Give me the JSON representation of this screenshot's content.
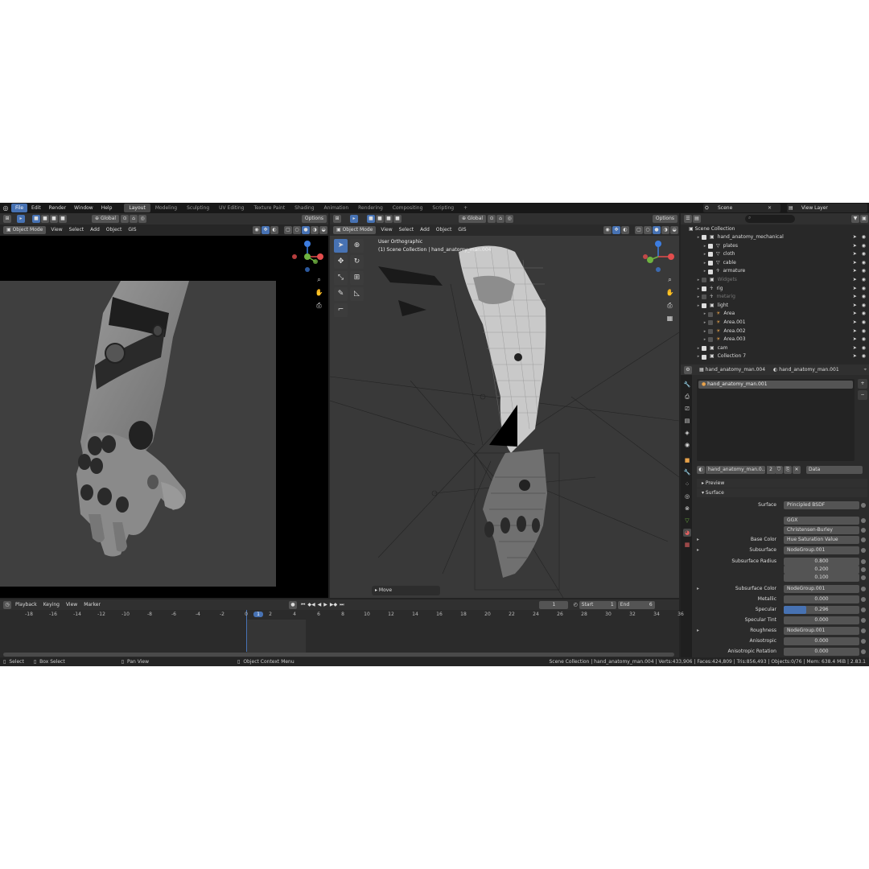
{
  "topbar": {
    "menus": [
      "File",
      "Edit",
      "Render",
      "Window",
      "Help"
    ],
    "workspaces": [
      "Layout",
      "Modeling",
      "Sculpting",
      "UV Editing",
      "Texture Paint",
      "Shading",
      "Animation",
      "Rendering",
      "Compositing",
      "Scripting"
    ],
    "add_tab": "+",
    "scene_label": "Scene",
    "view_layer_label": "View Layer"
  },
  "left_viewport": {
    "transform": "Global",
    "options": "Options",
    "mode": "Object Mode",
    "menus": [
      "View",
      "Select",
      "Add",
      "Object",
      "GIS"
    ]
  },
  "right_viewport": {
    "transform": "Global",
    "options": "Options",
    "mode": "Object Mode",
    "menus": [
      "View",
      "Select",
      "Add",
      "Object",
      "GIS"
    ],
    "overlay_title": "User Orthographic",
    "overlay_sub": "(1) Scene Collection | hand_anatomy_man.004",
    "last_op": "Move"
  },
  "outliner": {
    "root": "Scene Collection",
    "rows": [
      {
        "label": "hand_anatomy_mechanical",
        "indent": 0,
        "checked": true,
        "dim": false
      },
      {
        "label": "plates",
        "indent": 1,
        "checked": true,
        "dim": false
      },
      {
        "label": "cloth",
        "indent": 1,
        "checked": true,
        "dim": false
      },
      {
        "label": "cable",
        "indent": 1,
        "checked": true,
        "dim": false
      },
      {
        "label": "armature",
        "indent": 1,
        "checked": true,
        "dim": false
      },
      {
        "label": "Widgets",
        "indent": 0,
        "checked": false,
        "dim": true
      },
      {
        "label": "rig",
        "indent": 0,
        "checked": true,
        "dim": false
      },
      {
        "label": "metarig",
        "indent": 0,
        "checked": false,
        "dim": true
      },
      {
        "label": "light",
        "indent": 0,
        "checked": true,
        "dim": false
      },
      {
        "label": "Area",
        "indent": 1,
        "checked": false,
        "dim": false
      },
      {
        "label": "Area.001",
        "indent": 1,
        "checked": false,
        "dim": false
      },
      {
        "label": "Area.002",
        "indent": 1,
        "checked": false,
        "dim": false
      },
      {
        "label": "Area.003",
        "indent": 1,
        "checked": false,
        "dim": false
      },
      {
        "label": "cam",
        "indent": 0,
        "checked": true,
        "dim": false
      },
      {
        "label": "Collection 7",
        "indent": 0,
        "checked": true,
        "dim": false
      }
    ]
  },
  "properties": {
    "breadcrumb_object": "hand_anatomy_man.004",
    "breadcrumb_material": "hand_anatomy_man.001",
    "slot_item": "hand_anatomy_man.001",
    "material_name": "hand_anatomy_man.0...",
    "user_count": "2",
    "link_type": "Data",
    "panel_preview": "Preview",
    "panel_surface": "Surface",
    "rows": [
      {
        "label": "Surface",
        "value": "Principled BSDF",
        "num": false
      },
      {
        "label": "",
        "value": "GGX",
        "num": false
      },
      {
        "label": "",
        "value": "Christensen-Burley",
        "num": false
      },
      {
        "label": "Base Color",
        "value": "Hue Saturation Value",
        "num": false
      },
      {
        "label": "Subsurface",
        "value": "NodeGroup.001",
        "num": false
      },
      {
        "label": "Subsurface Radius",
        "value": "0.800",
        "num": true
      },
      {
        "label": "",
        "value": "0.200",
        "num": true
      },
      {
        "label": "",
        "value": "0.100",
        "num": true
      },
      {
        "label": "Subsurface Color",
        "value": "NodeGroup.001",
        "num": false
      },
      {
        "label": "Metallic",
        "value": "0.000",
        "num": true
      },
      {
        "label": "Specular",
        "value": "0.296",
        "num": true,
        "fill": 0.296
      },
      {
        "label": "Specular Tint",
        "value": "0.000",
        "num": true
      },
      {
        "label": "Roughness",
        "value": "NodeGroup.001",
        "num": false
      },
      {
        "label": "Anisotropic",
        "value": "0.000",
        "num": true
      },
      {
        "label": "Anisotropic Rotation",
        "value": "0.000",
        "num": true
      }
    ]
  },
  "timeline": {
    "menus": [
      "Playback",
      "Keying",
      "View",
      "Marker"
    ],
    "current_frame": "1",
    "start_label": "Start",
    "start": "1",
    "end_label": "End",
    "end": "6",
    "ticks": [
      "-18",
      "-16",
      "-14",
      "-12",
      "-10",
      "-8",
      "-6",
      "-4",
      "-2",
      "0",
      "1",
      "2",
      "4",
      "6",
      "8",
      "10",
      "12",
      "14",
      "16",
      "18",
      "20",
      "22",
      "24",
      "26",
      "28",
      "30",
      "32",
      "34",
      "36"
    ]
  },
  "statusbar": {
    "select": "Select",
    "box_select": "Box Select",
    "pan_view": "Pan View",
    "context_menu": "Object Context Menu",
    "stats": "Scene Collection | hand_anatomy_man.004 | Verts:433,906 | Faces:424,809 | Tris:856,493 | Objects:0/76 | Mem: 638.4 MiB | 2.83.1"
  },
  "colors": {
    "accent": "#4772b3",
    "axis_x": "#e34d4d",
    "axis_y": "#6fb341",
    "axis_z": "#3d7de0"
  }
}
